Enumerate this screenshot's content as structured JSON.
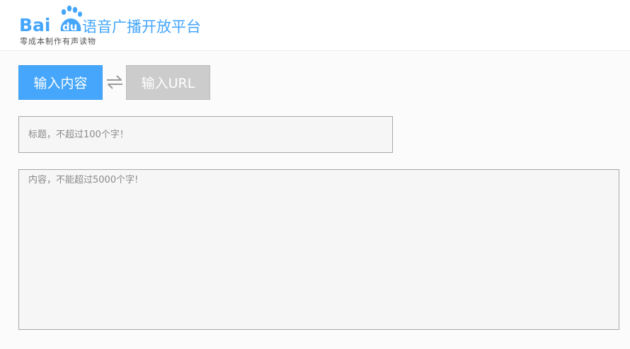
{
  "header": {
    "logo_text_bai": "Bai",
    "logo_text_du": "du",
    "logo_product": "语音广播开放平台",
    "tagline": "零成本制作有声读物",
    "brand_color": "#45a6fb"
  },
  "tabs": {
    "active_label": "输入内容",
    "inactive_label": "输入URL",
    "swap_icon": "swap-arrows-icon"
  },
  "form": {
    "title_placeholder": "标题，不超过100个字！",
    "title_value": "",
    "content_placeholder": "内容，不能超过5000个字!",
    "content_value": ""
  }
}
